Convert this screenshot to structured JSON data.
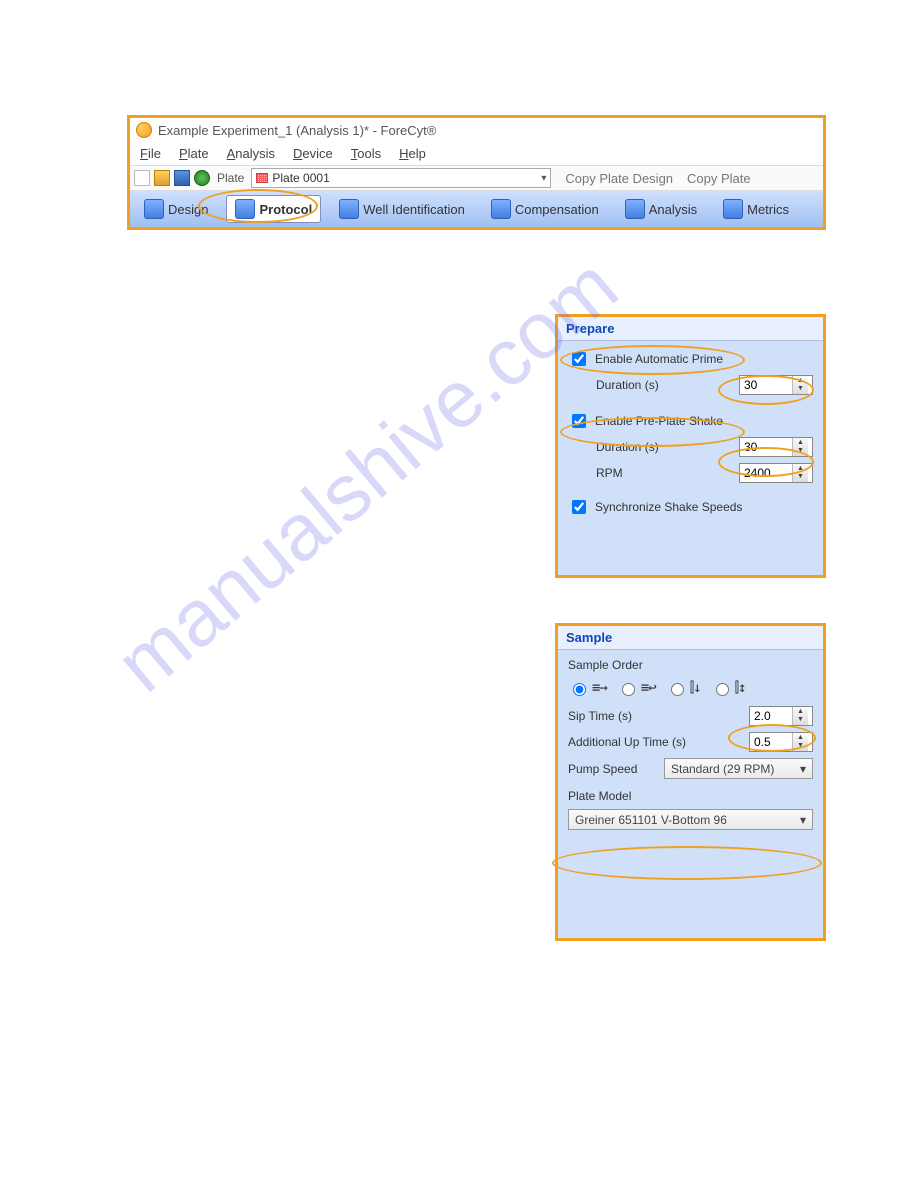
{
  "watermark": "manualshive.com",
  "window": {
    "title": "Example Experiment_1 (Analysis 1)* - ForeCyt®",
    "menu": {
      "file": "File",
      "plate": "Plate",
      "analysis": "Analysis",
      "device": "Device",
      "tools": "Tools",
      "help": "Help"
    },
    "plate_label": "Plate",
    "plate_combo": "Plate 0001",
    "copy_plate_design": "Copy Plate Design",
    "copy_plate": "Copy Plate",
    "tabs": {
      "design": "Design",
      "protocol": "Protocol",
      "well_id": "Well Identification",
      "compensation": "Compensation",
      "analysis": "Analysis",
      "metrics": "Metrics"
    }
  },
  "prepare": {
    "title": "Prepare",
    "auto_prime": "Enable Automatic Prime",
    "duration_label": "Duration (s)",
    "prime_duration": "30",
    "pre_plate_shake": "Enable Pre-Plate Shake",
    "shake_duration": "30",
    "rpm_label": "RPM",
    "rpm": "2400",
    "sync": "Synchronize Shake Speeds"
  },
  "sample": {
    "title": "Sample",
    "order_label": "Sample Order",
    "sip_label": "Sip Time (s)",
    "sip_value": "2.0",
    "addl_up_label": "Additional Up Time (s)",
    "addl_up_value": "0.5",
    "pump_label": "Pump Speed",
    "pump_value": "Standard (29 RPM)",
    "plate_model_label": "Plate Model",
    "plate_model_value": "Greiner 651101 V-Bottom 96"
  }
}
